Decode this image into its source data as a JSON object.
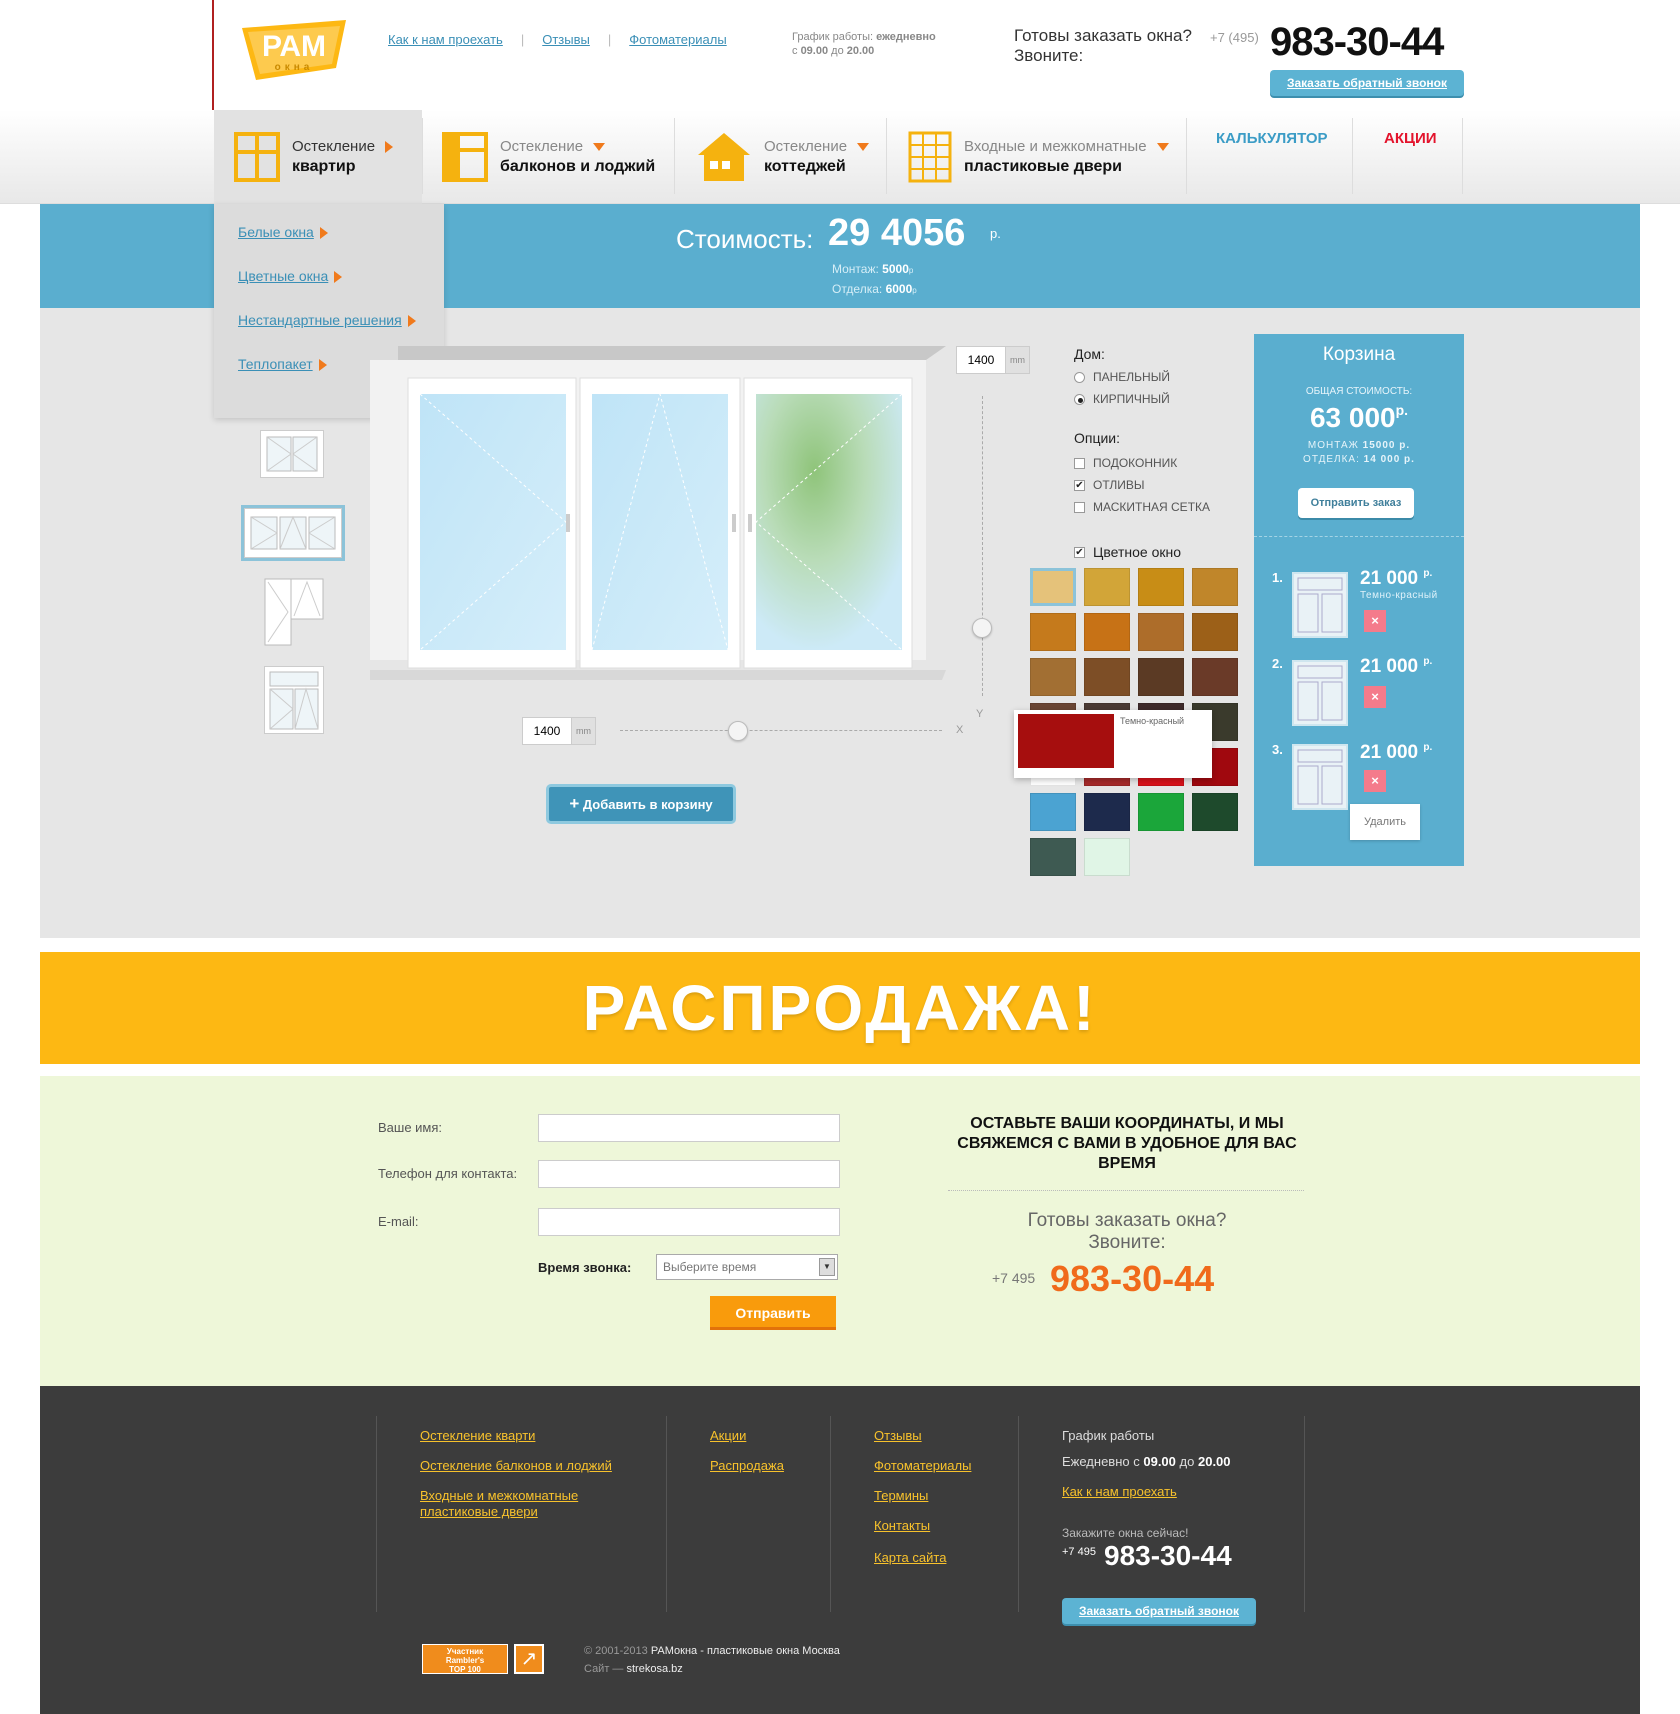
{
  "header": {
    "logo_text": "РАМ",
    "logo_sub": "окна",
    "links": [
      "Как к нам проехать",
      "Отзывы",
      "Фотоматериалы"
    ],
    "schedule_label": "График работы:",
    "schedule_days": "ежедневно",
    "schedule_from": "с",
    "schedule_start": "09.00",
    "schedule_to": "до",
    "schedule_end": "20.00",
    "ready_line1": "Готовы заказать окна?",
    "ready_line2": "Звоните:",
    "phone_prefix": "+7 (495)",
    "phone": "983-30-44",
    "callback_label": "Заказать обратный звонок"
  },
  "nav": {
    "items": [
      {
        "top": "Остекление",
        "bottom": "квартир"
      },
      {
        "top": "Остекление",
        "bottom": "балконов и лоджий"
      },
      {
        "top": "Остекление",
        "bottom": "коттеджей"
      },
      {
        "top": "Входные и межкомнатные",
        "bottom": "пластиковые двери"
      }
    ],
    "calculator": "КАЛЬКУЛЯТОР",
    "promo": "АКЦИИ"
  },
  "dropdown": [
    "Белые окна",
    "Цветные окна",
    "Нестандартные решения",
    "Теплопакет"
  ],
  "cost": {
    "label": "Стоимость:",
    "value": "29 4056",
    "currency": "р.",
    "mount_label": "Монтаж:",
    "mount_value": "5000",
    "finish_label": "Отделка:",
    "finish_value": "6000",
    "small_currency": "р"
  },
  "configurator": {
    "width_value": "1400",
    "height_value": "1400",
    "unit": "mm",
    "axis_x": "X",
    "axis_y": "Y",
    "add_to_cart": "Добавить в корзину",
    "house_label": "Дом:",
    "house_options": [
      "ПАНЕЛЬНЫЙ",
      "КИРПИЧНЫЙ"
    ],
    "house_selected": 1,
    "options_label": "Опции:",
    "options": [
      {
        "label": "ПОДОКОННИК",
        "checked": false
      },
      {
        "label": "ОТЛИВЫ",
        "checked": true
      },
      {
        "label": "МАСКИТНАЯ СЕТКА",
        "checked": false
      }
    ],
    "color_window_label": "Цветное окно",
    "color_window_checked": true,
    "swatches": [
      "#e5c27a",
      "#d2a538",
      "#c88d16",
      "#c0862a",
      "#c57a1c",
      "#c77216",
      "#ad6d2a",
      "#9c6018",
      "#a26f33",
      "#7d4e26",
      "#5b3a24",
      "#6a3a28",
      "#6a4634",
      "#4a3a34",
      "#3e2a2a",
      "#3a3a2c",
      "#ffffff",
      "#a52a2a",
      "#d8121a",
      "#a0080e",
      "#4ba3d2",
      "#1d2a4c",
      "#1ba63a",
      "#1e4a2c",
      "#3e5a52",
      "#e0f5e6"
    ],
    "tooltip_color": "#a60e0e",
    "tooltip_label": "Темно-красный"
  },
  "cart": {
    "title": "Корзина",
    "total_label": "ОБЩАЯ СТОИМОСТЬ:",
    "total": "63 000",
    "currency": "р.",
    "mount_label": "МОНТАЖ",
    "mount": "15000 р.",
    "finish_label": "ОТДЕЛКА:",
    "finish": "14 000 р.",
    "send_order": "Отправить заказ",
    "items": [
      {
        "num": "1.",
        "price": "21 000",
        "name": "Темно-красный"
      },
      {
        "num": "2.",
        "price": "21 000",
        "name": ""
      },
      {
        "num": "3.",
        "price": "21 000",
        "name": ""
      }
    ],
    "item_currency": "р.",
    "delete_icon": "×",
    "delete_tip": "Удалить"
  },
  "sale": {
    "title": "РАСПРОДАЖА!"
  },
  "form": {
    "name_label": "Ваше имя:",
    "phone_label": "Телефон для контакта:",
    "email_label": "E-mail:",
    "time_label": "Время звонка:",
    "time_placeholder": "Выберите время",
    "submit": "Отправить",
    "cta": "ОСТАВЬТЕ ВАШИ КООРДИНАТЫ, И МЫ СВЯЖЕМСЯ С ВАМИ В УДОБНОЕ ДЛЯ ВАС ВРЕМЯ",
    "ready_line1": "Готовы заказать окна?",
    "ready_line2": "Звоните:",
    "phone_prefix": "+7 495",
    "phone": "983-30-44"
  },
  "footer": {
    "col1": [
      "Остекление кварти",
      "Остекление балконов и лоджий",
      "Входные и межкомнатные пластиковые двери"
    ],
    "col2": [
      "Акции",
      "Распродажа"
    ],
    "col3": [
      "Отзывы",
      "Фотоматериалы",
      "Термины",
      "Контакты",
      "Карта сайта"
    ],
    "schedule_title": "График работы",
    "schedule_text": "Ежедневно с",
    "schedule_start": "09.00",
    "schedule_to": "до",
    "schedule_end": "20.00",
    "directions": "Как к нам проехать",
    "order_now": "Закажите окна сейчас!",
    "phone_prefix": "+7 495",
    "phone": "983-30-44",
    "callback": "Заказать обратный звонок",
    "rambler_line1": "Участник",
    "rambler_line2": "Rambler's",
    "rambler_line3": "TOP 100",
    "copyright": "© 2001-2013",
    "copyright_brand": "РАМокна - пластиковые окна Москва",
    "site_label": "Сайт —",
    "site": "strekosa.bz"
  },
  "colors": {
    "accent_blue": "#5aaecf",
    "accent_orange": "#f06a1b",
    "sale_yellow": "#fdb813",
    "footer_bg": "#3c3c3c"
  }
}
